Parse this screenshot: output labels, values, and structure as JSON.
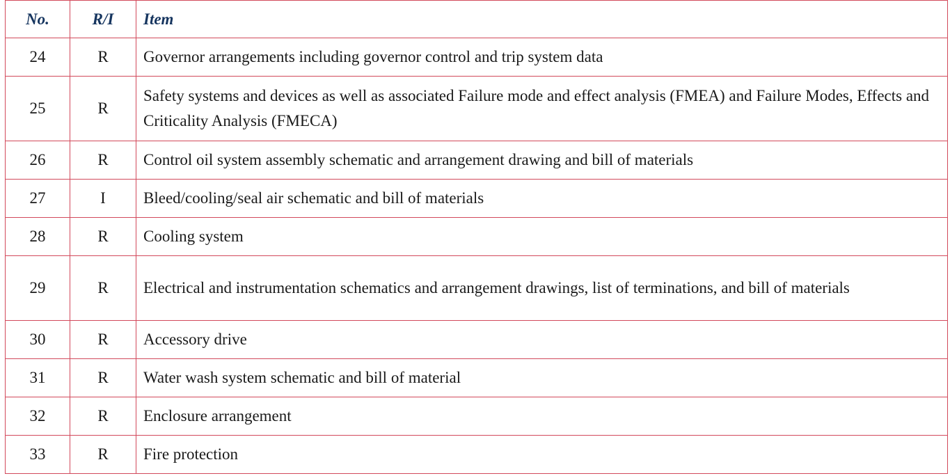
{
  "table": {
    "headers": {
      "no": "No.",
      "ri": "R/I",
      "item": "Item"
    },
    "rows": [
      {
        "no": "24",
        "ri": "R",
        "item": "Governor arrangements including governor control and trip system data"
      },
      {
        "no": "25",
        "ri": "R",
        "item": "Safety systems and devices as well as associated Failure mode and effect analysis (FMEA) and Failure Modes, Effects and Criticality Analysis (FMECA)"
      },
      {
        "no": "26",
        "ri": "R",
        "item": "Control oil system assembly schematic and arrangement drawing and bill of materials"
      },
      {
        "no": "27",
        "ri": "I",
        "item": "Bleed/cooling/seal air schematic and bill of materials"
      },
      {
        "no": "28",
        "ri": "R",
        "item": "Cooling system"
      },
      {
        "no": "29",
        "ri": "R",
        "item": "Electrical and instrumentation schematics and arrangement drawings, list of terminations, and bill of materials"
      },
      {
        "no": "30",
        "ri": "R",
        "item": "Accessory drive"
      },
      {
        "no": "31",
        "ri": "R",
        "item": "Water wash system schematic and bill of material"
      },
      {
        "no": "32",
        "ri": "R",
        "item": "Enclosure arrangement"
      },
      {
        "no": "33",
        "ri": "R",
        "item": "Fire protection"
      }
    ]
  },
  "colors": {
    "border": "#d2495b",
    "header_text": "#16355f",
    "body_text": "#1a1a1a"
  }
}
